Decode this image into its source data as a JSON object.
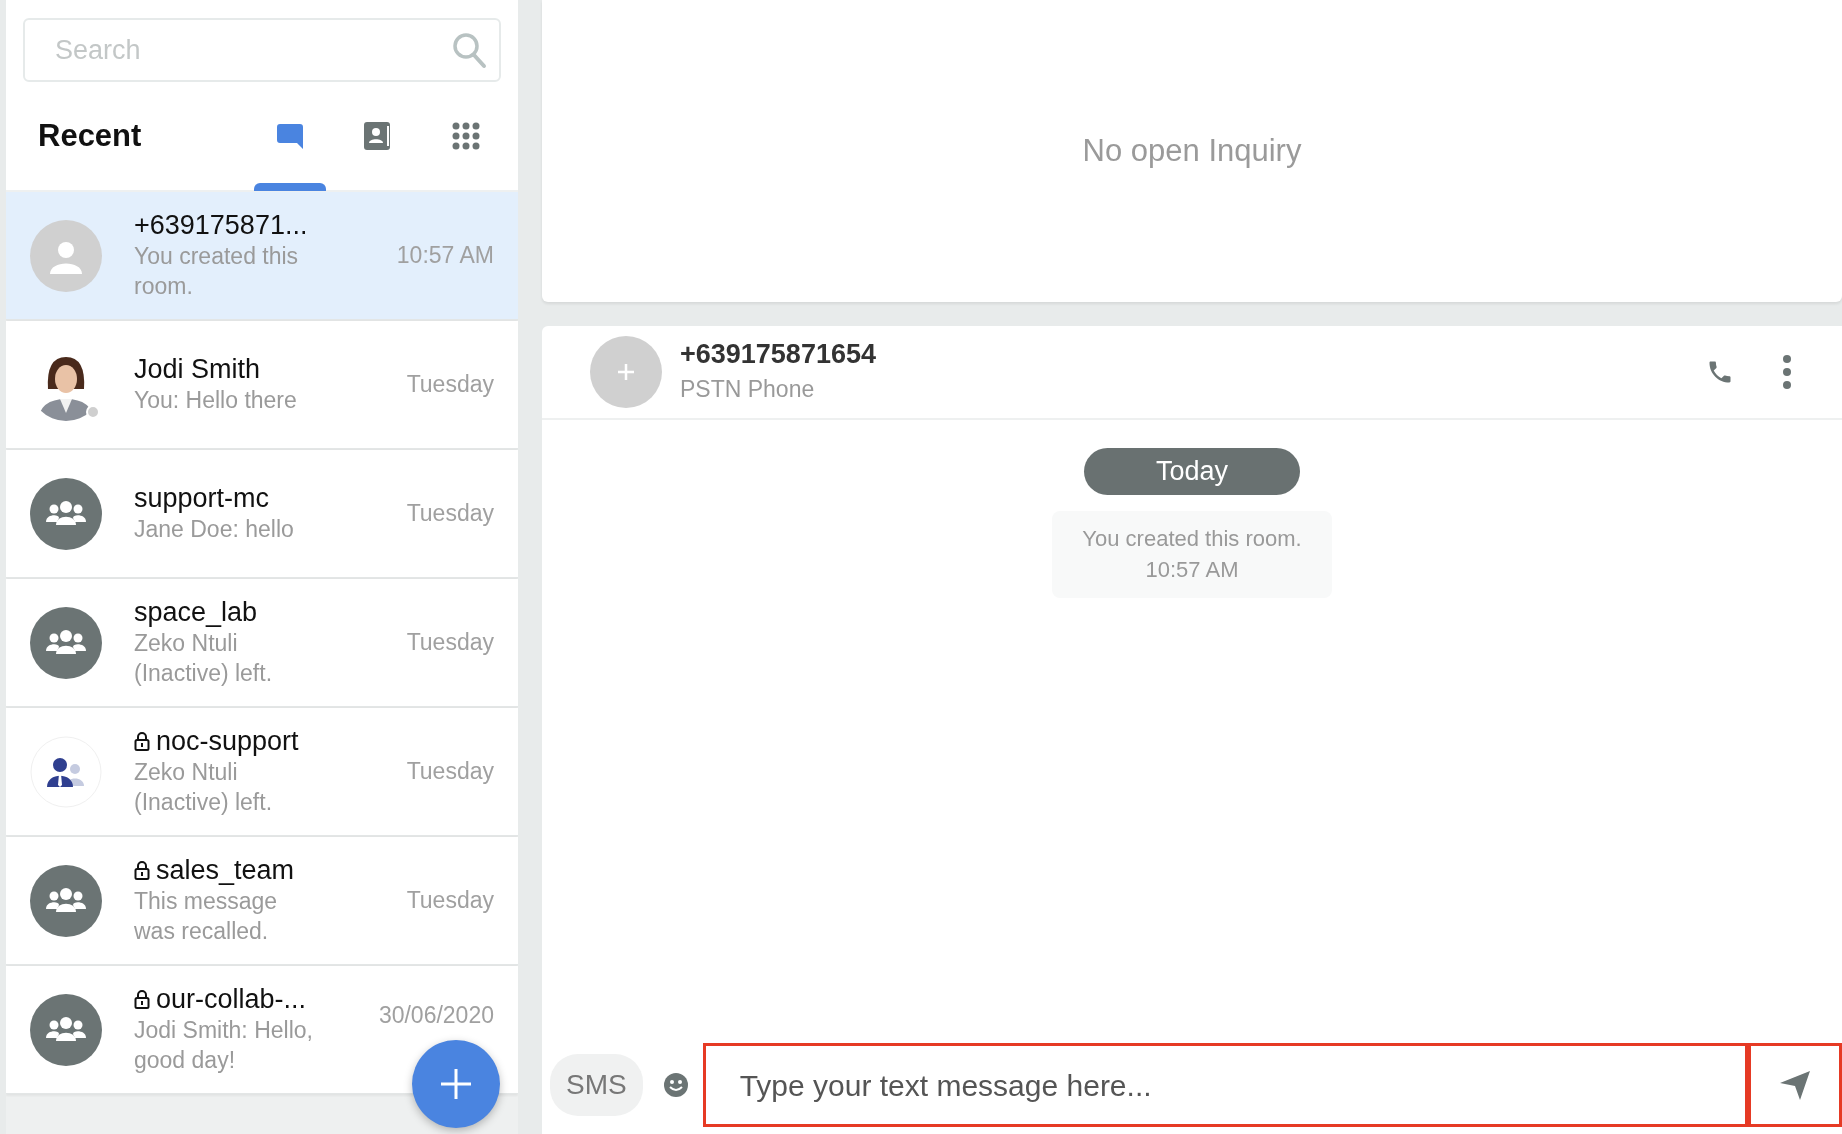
{
  "search": {
    "placeholder": "Search"
  },
  "recent": {
    "title": "Recent",
    "tabs": [
      {
        "kind": "chat",
        "selected": true
      },
      {
        "kind": "contacts",
        "selected": false
      },
      {
        "kind": "apps",
        "selected": false
      }
    ]
  },
  "conversations": [
    {
      "kind": "person",
      "locked": false,
      "name": "+639175871...",
      "preview": "You created this room.",
      "time": "10:57 AM",
      "selected": true
    },
    {
      "kind": "picture",
      "locked": false,
      "name": "Jodi Smith",
      "preview": "You: Hello there",
      "time": "Tuesday",
      "selected": false
    },
    {
      "kind": "group",
      "locked": false,
      "name": "support-mc",
      "preview": "Jane Doe: hello",
      "time": "Tuesday",
      "selected": false
    },
    {
      "kind": "group",
      "locked": false,
      "name": "space_lab",
      "preview": "Zeko Ntuli (Inactive) left.",
      "time": "Tuesday",
      "selected": false
    },
    {
      "kind": "team",
      "locked": true,
      "name": "noc-support",
      "preview": "Zeko Ntuli (Inactive) left.",
      "time": "Tuesday",
      "selected": false
    },
    {
      "kind": "group",
      "locked": true,
      "name": "sales_team",
      "preview": "This message was recalled.",
      "time": "Tuesday",
      "selected": false
    },
    {
      "kind": "group",
      "locked": true,
      "name": "our-collab-...",
      "preview": "Jodi Smith: Hello, good day!",
      "time": "30/06/2020",
      "selected": false
    }
  ],
  "inquiry": {
    "message": "No open Inquiry"
  },
  "chat": {
    "header": {
      "title": "+639175871654",
      "subtitle": "PSTN Phone"
    },
    "date_divider": "Today",
    "system_message": {
      "text": "You created this room.",
      "time": "10:57 AM"
    },
    "composer": {
      "channel": "SMS",
      "placeholder": "Type your text message here...",
      "highlighted": true
    }
  }
}
